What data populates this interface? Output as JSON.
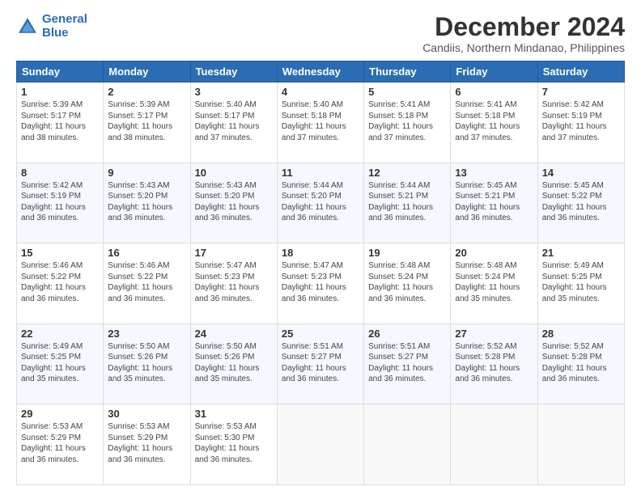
{
  "header": {
    "logo_line1": "General",
    "logo_line2": "Blue",
    "title": "December 2024",
    "subtitle": "Candiis, Northern Mindanao, Philippines"
  },
  "days_of_week": [
    "Sunday",
    "Monday",
    "Tuesday",
    "Wednesday",
    "Thursday",
    "Friday",
    "Saturday"
  ],
  "weeks": [
    [
      {
        "day": "1",
        "sunrise": "5:39 AM",
        "sunset": "5:17 PM",
        "daylight": "11 hours and 38 minutes."
      },
      {
        "day": "2",
        "sunrise": "5:39 AM",
        "sunset": "5:17 PM",
        "daylight": "11 hours and 38 minutes."
      },
      {
        "day": "3",
        "sunrise": "5:40 AM",
        "sunset": "5:17 PM",
        "daylight": "11 hours and 37 minutes."
      },
      {
        "day": "4",
        "sunrise": "5:40 AM",
        "sunset": "5:18 PM",
        "daylight": "11 hours and 37 minutes."
      },
      {
        "day": "5",
        "sunrise": "5:41 AM",
        "sunset": "5:18 PM",
        "daylight": "11 hours and 37 minutes."
      },
      {
        "day": "6",
        "sunrise": "5:41 AM",
        "sunset": "5:18 PM",
        "daylight": "11 hours and 37 minutes."
      },
      {
        "day": "7",
        "sunrise": "5:42 AM",
        "sunset": "5:19 PM",
        "daylight": "11 hours and 37 minutes."
      }
    ],
    [
      {
        "day": "8",
        "sunrise": "5:42 AM",
        "sunset": "5:19 PM",
        "daylight": "11 hours and 36 minutes."
      },
      {
        "day": "9",
        "sunrise": "5:43 AM",
        "sunset": "5:20 PM",
        "daylight": "11 hours and 36 minutes."
      },
      {
        "day": "10",
        "sunrise": "5:43 AM",
        "sunset": "5:20 PM",
        "daylight": "11 hours and 36 minutes."
      },
      {
        "day": "11",
        "sunrise": "5:44 AM",
        "sunset": "5:20 PM",
        "daylight": "11 hours and 36 minutes."
      },
      {
        "day": "12",
        "sunrise": "5:44 AM",
        "sunset": "5:21 PM",
        "daylight": "11 hours and 36 minutes."
      },
      {
        "day": "13",
        "sunrise": "5:45 AM",
        "sunset": "5:21 PM",
        "daylight": "11 hours and 36 minutes."
      },
      {
        "day": "14",
        "sunrise": "5:45 AM",
        "sunset": "5:22 PM",
        "daylight": "11 hours and 36 minutes."
      }
    ],
    [
      {
        "day": "15",
        "sunrise": "5:46 AM",
        "sunset": "5:22 PM",
        "daylight": "11 hours and 36 minutes."
      },
      {
        "day": "16",
        "sunrise": "5:46 AM",
        "sunset": "5:22 PM",
        "daylight": "11 hours and 36 minutes."
      },
      {
        "day": "17",
        "sunrise": "5:47 AM",
        "sunset": "5:23 PM",
        "daylight": "11 hours and 36 minutes."
      },
      {
        "day": "18",
        "sunrise": "5:47 AM",
        "sunset": "5:23 PM",
        "daylight": "11 hours and 36 minutes."
      },
      {
        "day": "19",
        "sunrise": "5:48 AM",
        "sunset": "5:24 PM",
        "daylight": "11 hours and 36 minutes."
      },
      {
        "day": "20",
        "sunrise": "5:48 AM",
        "sunset": "5:24 PM",
        "daylight": "11 hours and 35 minutes."
      },
      {
        "day": "21",
        "sunrise": "5:49 AM",
        "sunset": "5:25 PM",
        "daylight": "11 hours and 35 minutes."
      }
    ],
    [
      {
        "day": "22",
        "sunrise": "5:49 AM",
        "sunset": "5:25 PM",
        "daylight": "11 hours and 35 minutes."
      },
      {
        "day": "23",
        "sunrise": "5:50 AM",
        "sunset": "5:26 PM",
        "daylight": "11 hours and 35 minutes."
      },
      {
        "day": "24",
        "sunrise": "5:50 AM",
        "sunset": "5:26 PM",
        "daylight": "11 hours and 35 minutes."
      },
      {
        "day": "25",
        "sunrise": "5:51 AM",
        "sunset": "5:27 PM",
        "daylight": "11 hours and 36 minutes."
      },
      {
        "day": "26",
        "sunrise": "5:51 AM",
        "sunset": "5:27 PM",
        "daylight": "11 hours and 36 minutes."
      },
      {
        "day": "27",
        "sunrise": "5:52 AM",
        "sunset": "5:28 PM",
        "daylight": "11 hours and 36 minutes."
      },
      {
        "day": "28",
        "sunrise": "5:52 AM",
        "sunset": "5:28 PM",
        "daylight": "11 hours and 36 minutes."
      }
    ],
    [
      {
        "day": "29",
        "sunrise": "5:53 AM",
        "sunset": "5:29 PM",
        "daylight": "11 hours and 36 minutes."
      },
      {
        "day": "30",
        "sunrise": "5:53 AM",
        "sunset": "5:29 PM",
        "daylight": "11 hours and 36 minutes."
      },
      {
        "day": "31",
        "sunrise": "5:53 AM",
        "sunset": "5:30 PM",
        "daylight": "11 hours and 36 minutes."
      },
      null,
      null,
      null,
      null
    ]
  ],
  "labels": {
    "sunrise": "Sunrise:",
    "sunset": "Sunset:",
    "daylight": "Daylight:"
  }
}
